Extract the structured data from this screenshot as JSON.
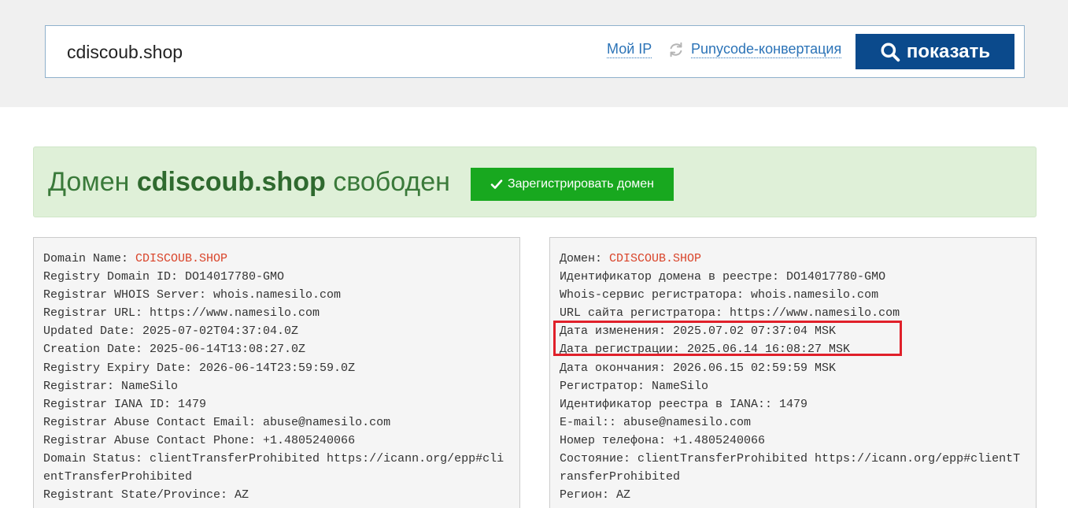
{
  "search": {
    "value": "cdiscoub.shop",
    "my_ip_label": "Мой IP",
    "punycode_label": "Punycode-конвертация",
    "show_label": "показать"
  },
  "status": {
    "prefix": "Домен ",
    "domain": "cdiscoub.shop",
    "suffix": " свободен",
    "register_label": "Зарегистрировать домен",
    "color_bg": "#dff0d8",
    "color_button": "#18a81f"
  },
  "whois_en": {
    "domain_label": "Domain Name: ",
    "domain_value": "CDISCOUB.SHOP",
    "lines": [
      "Registry Domain ID: DO14017780-GMO",
      "Registrar WHOIS Server: whois.namesilo.com",
      "Registrar URL: https://www.namesilo.com",
      "Updated Date: 2025-07-02T04:37:04.0Z",
      "Creation Date: 2025-06-14T13:08:27.0Z",
      "Registry Expiry Date: 2026-06-14T23:59:59.0Z",
      "Registrar: NameSilo",
      "Registrar IANA ID: 1479",
      "Registrar Abuse Contact Email: abuse@namesilo.com",
      "Registrar Abuse Contact Phone: +1.4805240066",
      "Domain Status: clientTransferProhibited https://icann.org/epp#clientTransferProhibited",
      "Registrant State/Province: AZ"
    ]
  },
  "whois_ru": {
    "domain_label": "Домен: ",
    "domain_value": "CDISCOUB.SHOP",
    "lines": [
      "Идентификатор домена в реестре: DO14017780-GMO",
      "Whois-сервис регистратора: whois.namesilo.com",
      "URL сайта регистратора: https://www.namesilo.com",
      "Дата изменения: 2025.07.02 07:37:04 MSK",
      "Дата регистрации: 2025.06.14 16:08:27 MSK",
      "Дата окончания: 2026.06.15 02:59:59 MSK",
      "Регистратор: NameSilo",
      "Идентификатор реестра в IANA:: 1479",
      "E-mail:: abuse@namesilo.com",
      "Номер телефона: +1.4805240066",
      "Состояние: clientTransferProhibited https://icann.org/epp#clientTransferProhibited",
      "Регион: AZ"
    ]
  },
  "colors": {
    "accent_button": "#0b4a8c",
    "link": "#2b73b7",
    "domain_highlight": "#d9442a",
    "annotation_box": "#e0202a"
  }
}
